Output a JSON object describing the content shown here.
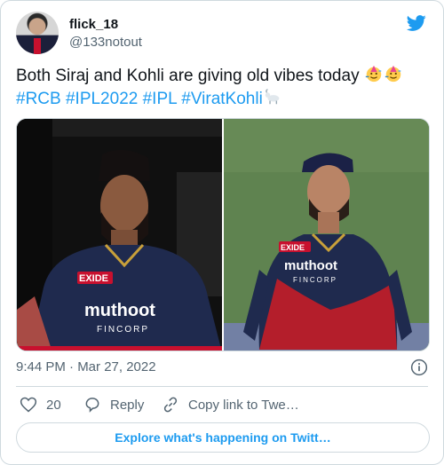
{
  "author": {
    "name": "flick_18",
    "handle": "@133notout"
  },
  "tweet": {
    "text": "Both Siraj and Kohli are giving old vibes today",
    "hashtags": [
      "#RCB",
      "#IPL2022",
      "#IPL",
      "#ViratKohli"
    ],
    "emojis": [
      "partying-face",
      "partying-face",
      "goat"
    ]
  },
  "meta": {
    "timestamp": "9:44 PM · Mar 27, 2022"
  },
  "actions": {
    "like_count": "20",
    "reply_label": "Reply",
    "copy_label": "Copy link to Twe…"
  },
  "explore_label": "Explore what's happening on Twitt…",
  "media": {
    "left_jersey_brand": "muthoot",
    "left_jersey_sub": "FINCORP",
    "left_sleeve": "EXIDE",
    "right_jersey_brand": "muthoot",
    "right_jersey_sub": "FINCORP",
    "right_sleeve": "EXIDE"
  },
  "colors": {
    "accent": "#1d9bf0",
    "secondary_text": "#536471",
    "border": "#cfd9de"
  }
}
